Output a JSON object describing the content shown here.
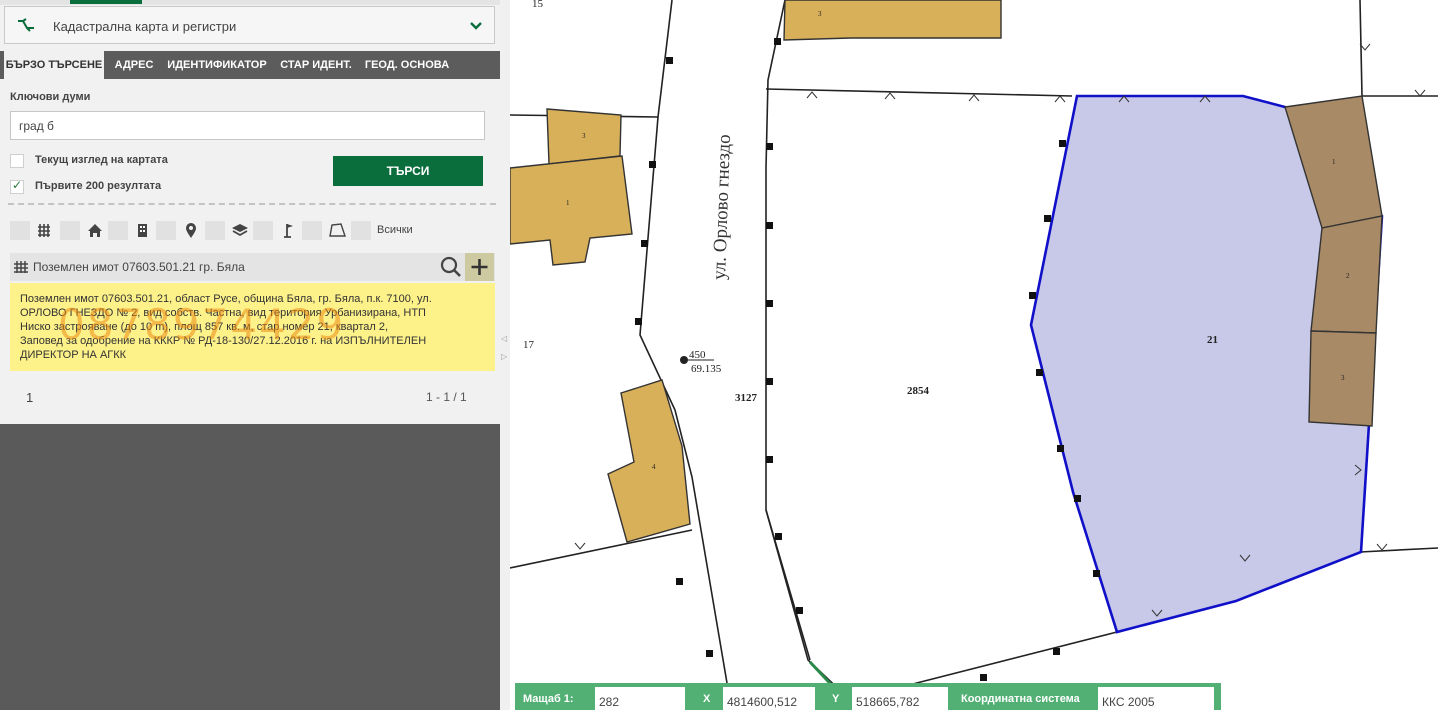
{
  "panel": {
    "dropdown": {
      "label": "Кадастрална карта и регистри",
      "icon": "cadastre-icon"
    },
    "tabs": [
      "БЪРЗО ТЪРСЕНЕ",
      "АДРЕС",
      "ИДЕНТИФИКАТОР",
      "СТАР ИДЕНТ.",
      "ГЕОД. ОСНОВА"
    ],
    "keywords_label": "Ключови думи",
    "keywords_value": "град б",
    "checkbox_current_view": {
      "label": "Текущ изглед на картата",
      "checked": false
    },
    "checkbox_first_200": {
      "label": "Първите 200 резултата",
      "checked": true
    },
    "search_button": "ТЪРСИ",
    "filters": [
      "parcel-grid-icon",
      "house-icon",
      "building-icon",
      "location-pin-icon",
      "layers-icon",
      "survey-flag-icon",
      "polygon-icon"
    ],
    "filter_all_label": "Всички"
  },
  "result": {
    "title": "Поземлен имот 07603.501.21 гр. Бяла",
    "description_lines": [
      "Поземлен имот 07603.501.21, област Русе, община Бяла, гр. Бяла, п.к. 7100, ул.",
      "ОРЛОВО ГНЕЗДО № 2, вид собств. Частна, вид територия Урбанизирана, НТП",
      "Ниско застрояване (до 10 m), площ 857 кв. м, стар номер 21, квартал 2,",
      "Заповед за одобрение на КККР № РД-18-130/27.12.2016 г. на ИЗПЪЛНИТЕЛЕН",
      "ДИРЕКТОР НА АГКК"
    ],
    "watermark": "0878974429",
    "page": "1",
    "range": "1 - 1 / 1"
  },
  "map": {
    "street_name": "ул. Орлово гнездо",
    "labels": {
      "p17": "17",
      "p3127": "3127",
      "p2854": "2854",
      "p21": "21",
      "top_cut": "15",
      "frac_num": "450",
      "frac_den": "69.135"
    },
    "building_labels": [
      "3",
      "3",
      "1",
      "4",
      "1",
      "2",
      "3"
    ],
    "colors": {
      "selected_fill": "#c8c8e8",
      "selected_stroke": "#1010c8",
      "building_tan": "#d9b05a",
      "building_brown": "#a88a66"
    }
  },
  "status": {
    "scale_label": "Мащаб 1:",
    "scale_value": "282",
    "x_label": "X",
    "x_value": "4814600,512",
    "y_label": "Y",
    "y_value": "518665,782",
    "crs_label": "Координатна система",
    "crs_value": "ККС 2005"
  }
}
